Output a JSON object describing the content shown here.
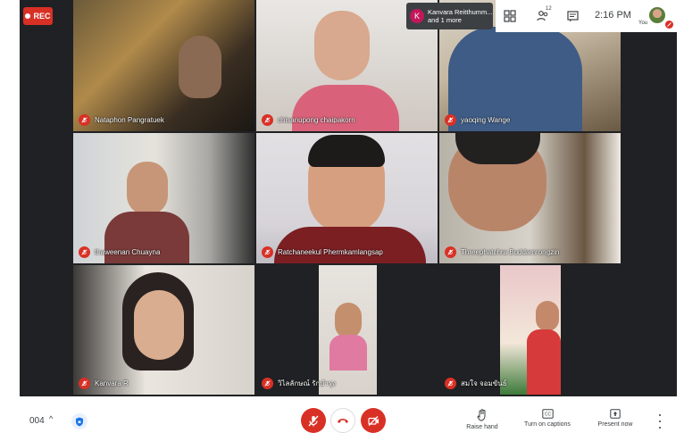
{
  "recording": {
    "label": "REC"
  },
  "notification": {
    "initial": "K",
    "line1": "Kanvara Reitthumm...",
    "line2": "and 1 more"
  },
  "topbar": {
    "participant_count": "12",
    "time": "2:16 PM",
    "you_label": "You"
  },
  "participants": [
    {
      "name": "Nataphon Pangratuek",
      "muted": true
    },
    {
      "name": "chisanupong chaipakorn",
      "muted": true
    },
    {
      "name": "yaoqing Wange",
      "muted": true
    },
    {
      "name": "thaweenan Chuayna",
      "muted": true
    },
    {
      "name": "Ratchaneekul Phermkamlangsap",
      "muted": true
    },
    {
      "name": "Threephatchra Buddamrongzin",
      "muted": true
    },
    {
      "name": "Kanvara R",
      "muted": true
    },
    {
      "name": "วิไลลักษณ์ รักบำรุง",
      "muted": true
    },
    {
      "name": "สมใจ จอมขันธ์",
      "muted": true
    }
  ],
  "bottombar": {
    "meeting_code": "004",
    "raise_hand": "Raise hand",
    "captions": "Turn on captions",
    "present": "Present now"
  },
  "colors": {
    "danger": "#d93025",
    "stage": "#202124",
    "text": "#3c4043"
  }
}
